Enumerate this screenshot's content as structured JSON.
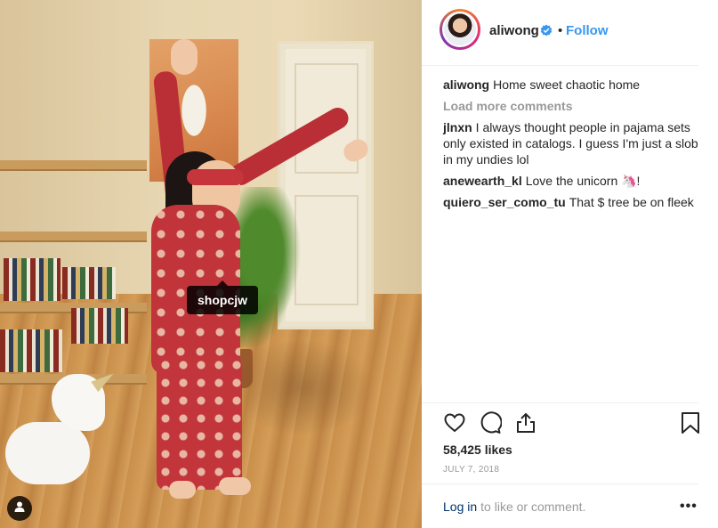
{
  "post": {
    "photo_tag": "shopcjw",
    "user_tag_icon": "person-icon"
  },
  "header": {
    "username": "aliwong",
    "verified_icon": "verified-badge-icon",
    "separator": "•",
    "follow_label": "Follow",
    "follow_color": "#3897f0"
  },
  "caption": {
    "username": "aliwong",
    "text": "Home sweet chaotic home"
  },
  "load_more_label": "Load more comments",
  "comments": [
    {
      "username": "jlnxn",
      "text": "I always thought people in pajama sets only existed in catalogs. I guess I'm just a slob in my undies lol"
    },
    {
      "username": "anewearth_kl",
      "text": "Love the unicorn 🦄!"
    },
    {
      "username": "quiero_ser_como_tu",
      "text": "That $ tree be on fleek"
    }
  ],
  "actions": {
    "like_icon": "heart-icon",
    "comment_icon": "comment-icon",
    "share_icon": "share-icon",
    "save_icon": "bookmark-icon"
  },
  "likes_text": "58,425 likes",
  "date_text": "JULY 7, 2018",
  "footer": {
    "login_link": "Log in",
    "login_suffix": "to like or comment.",
    "more_label": "•••"
  }
}
